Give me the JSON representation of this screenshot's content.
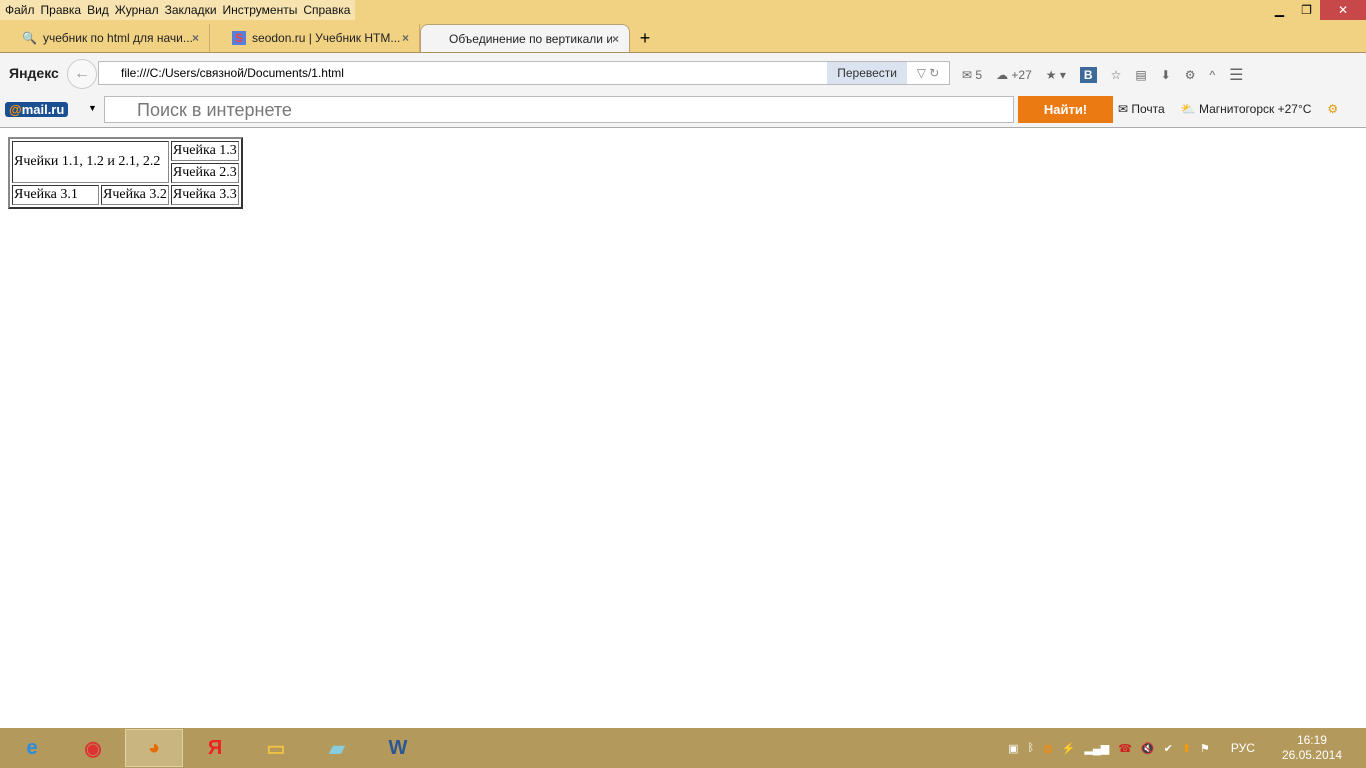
{
  "menu": [
    "Файл",
    "Правка",
    "Вид",
    "Журнал",
    "Закладки",
    "Инструменты",
    "Справка"
  ],
  "tabs": [
    {
      "label": "учебник по html для начи...",
      "icon": "mail-search-icon"
    },
    {
      "label": "seodon.ru | Учебник HTM...",
      "icon": "seodon-icon"
    },
    {
      "label": "Объединение по вертикали и ...",
      "icon": ""
    }
  ],
  "nav": {
    "logo": "Яндекс",
    "url": "file:///C:/Users/связной/Documents/1.html",
    "translate": "Перевести",
    "mail_count": "5",
    "weather": "+27"
  },
  "search": {
    "brand": "@mail.ru",
    "placeholder": "Поиск в интернете",
    "button": "Найти!",
    "mail_link": "Почта",
    "weather": "Магнитогорск +27°C"
  },
  "table": {
    "merged": "Ячейки 1.1, 1.2 и 2.1, 2.2",
    "c13": "Ячейка 1.3",
    "c23": "Ячейка 2.3",
    "c31": "Ячейка 3.1",
    "c32": "Ячейка 3.2",
    "c33": "Ячейка 3.3"
  },
  "taskbar": {
    "lang": "РУС",
    "time": "16:19",
    "date": "26.05.2014"
  }
}
